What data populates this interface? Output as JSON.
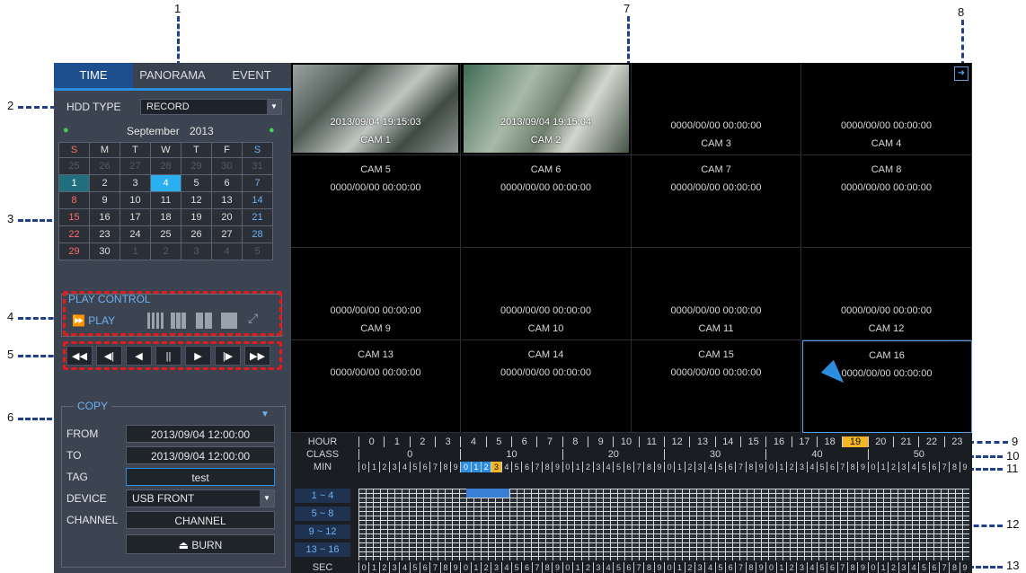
{
  "callouts": [
    "1",
    "2",
    "3",
    "4",
    "5",
    "6",
    "7",
    "8",
    "9",
    "10",
    "11",
    "12",
    "13"
  ],
  "tabs": [
    {
      "label": "TIME",
      "active": true
    },
    {
      "label": "PANORAMA",
      "active": false
    },
    {
      "label": "EVENT",
      "active": false
    }
  ],
  "hdd_type": {
    "label": "HDD TYPE",
    "value": "RECORD"
  },
  "calendar": {
    "month_label": "September",
    "year": "2013",
    "weekdays": [
      "S",
      "M",
      "T",
      "W",
      "T",
      "F",
      "S"
    ],
    "weeks": [
      [
        "25",
        "26",
        "27",
        "28",
        "29",
        "30",
        "31"
      ],
      [
        "1",
        "2",
        "3",
        "4",
        "5",
        "6",
        "7"
      ],
      [
        "8",
        "9",
        "10",
        "11",
        "12",
        "13",
        "14"
      ],
      [
        "15",
        "16",
        "17",
        "18",
        "19",
        "20",
        "21"
      ],
      [
        "22",
        "23",
        "24",
        "25",
        "26",
        "27",
        "28"
      ],
      [
        "29",
        "30",
        "1",
        "2",
        "3",
        "4",
        "5"
      ]
    ],
    "selected_day": "4"
  },
  "play_control": {
    "title": "PLAY CONTROL",
    "play_label": "PLAY"
  },
  "playback_buttons": [
    "◀◀",
    "◀|",
    "◀",
    "||",
    "▶",
    "|▶",
    "▶▶"
  ],
  "copy": {
    "title": "COPY",
    "from_label": "FROM",
    "from_value": "2013/09/04 12:00:00",
    "to_label": "TO",
    "to_value": "2013/09/04 12:00:00",
    "tag_label": "TAG",
    "tag_value": "test",
    "device_label": "DEVICE",
    "device_value": "USB FRONT",
    "channel_label": "CHANNEL",
    "channel_button": "CHANNEL",
    "burn_button": "BURN"
  },
  "cameras": [
    {
      "name": "CAM 1",
      "time": "2013/09/04 19:15:03",
      "live": true
    },
    {
      "name": "CAM 2",
      "time": "2013/09/04 19:15:04",
      "live": true
    },
    {
      "name": "CAM 3",
      "time": "0000/00/00 00:00:00"
    },
    {
      "name": "CAM 4",
      "time": "0000/00/00 00:00:00"
    },
    {
      "name": "CAM 5",
      "time": "0000/00/00 00:00:00"
    },
    {
      "name": "CAM 6",
      "time": "0000/00/00 00:00:00"
    },
    {
      "name": "CAM 7",
      "time": "0000/00/00 00:00:00"
    },
    {
      "name": "CAM 8",
      "time": "0000/00/00 00:00:00"
    },
    {
      "name": "CAM 9",
      "time": "0000/00/00 00:00:00"
    },
    {
      "name": "CAM 10",
      "time": "0000/00/00 00:00:00"
    },
    {
      "name": "CAM 11",
      "time": "0000/00/00 00:00:00"
    },
    {
      "name": "CAM 12",
      "time": "0000/00/00 00:00:00"
    },
    {
      "name": "CAM 13",
      "time": "0000/00/00 00:00:00"
    },
    {
      "name": "CAM 14",
      "time": "0000/00/00 00:00:00"
    },
    {
      "name": "CAM 15",
      "time": "0000/00/00 00:00:00"
    },
    {
      "name": "CAM 16",
      "time": "0000/00/00 00:00:00",
      "selected": true
    }
  ],
  "timeline": {
    "hour_label": "HOUR",
    "hours": [
      "0",
      "1",
      "2",
      "3",
      "4",
      "5",
      "6",
      "7",
      "8",
      "9",
      "10",
      "11",
      "12",
      "13",
      "14",
      "15",
      "16",
      "17",
      "18",
      "19",
      "20",
      "21",
      "22",
      "23"
    ],
    "highlight_hour": "19",
    "class_label": "CLASS",
    "classes": [
      "0",
      "10",
      "20",
      "30",
      "40",
      "50"
    ],
    "min_label": "MIN",
    "min_digits": [
      "0",
      "1",
      "2",
      "3",
      "4",
      "5",
      "6",
      "7",
      "8",
      "9"
    ],
    "channel_groups": [
      "1 ~ 4",
      "5 ~ 8",
      "9 ~ 12",
      "13 ~ 16"
    ],
    "sec_label": "SEC"
  },
  "colors": {
    "accent": "#2a8de0",
    "highlight": "#f3b526",
    "callout_line": "#1f3f8a",
    "red_box": "#e21b1b"
  }
}
